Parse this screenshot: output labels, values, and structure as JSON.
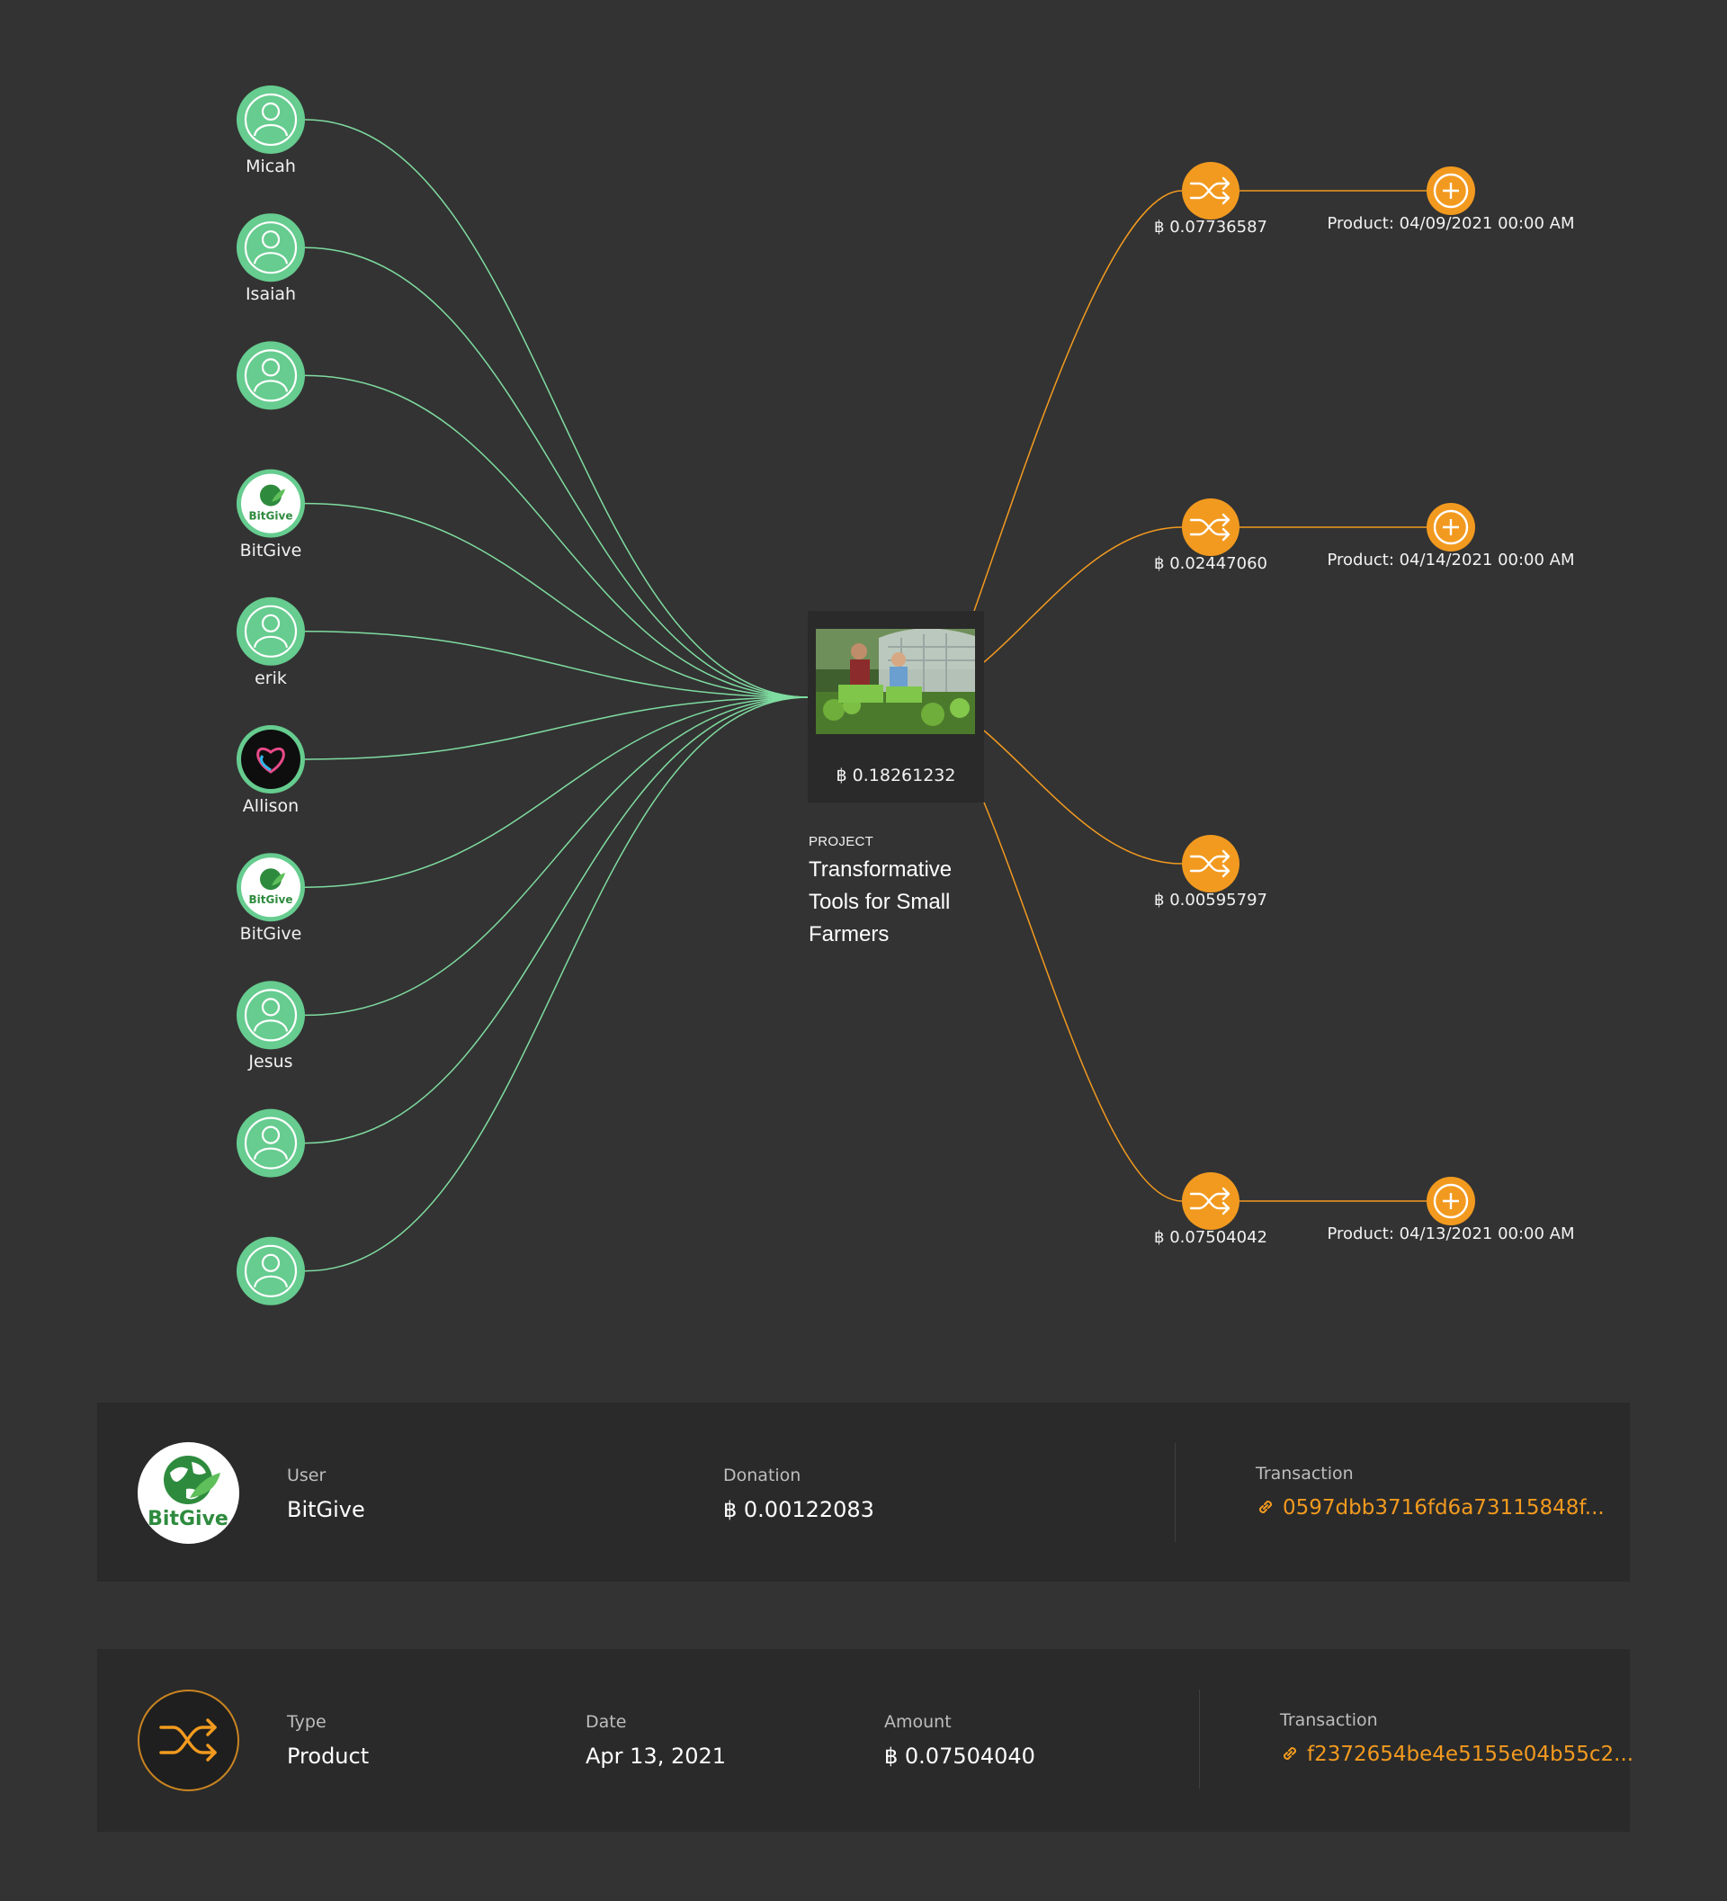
{
  "donors": [
    {
      "name": "Micah",
      "type": "user"
    },
    {
      "name": "Isaiah",
      "type": "user"
    },
    {
      "name": "",
      "type": "user"
    },
    {
      "name": "BitGive",
      "type": "bitgive",
      "logo_text": "BitGive"
    },
    {
      "name": "erik",
      "type": "user"
    },
    {
      "name": "Allison",
      "type": "heart"
    },
    {
      "name": "BitGive",
      "type": "bitgive",
      "logo_text": "BitGive"
    },
    {
      "name": "Jesus",
      "type": "user"
    },
    {
      "name": "",
      "type": "user"
    },
    {
      "name": "",
      "type": "user"
    }
  ],
  "project": {
    "amount": "฿ 0.18261232",
    "kicker": "PROJECT",
    "title": "Transformative Tools for Small Farmers"
  },
  "transactions": [
    {
      "amount": "฿ 0.07736587",
      "product": "Product: 04/09/2021 00:00 AM"
    },
    {
      "amount": "฿ 0.02447060",
      "product": "Product: 04/14/2021 00:00 AM"
    },
    {
      "amount": "฿ 0.00595797",
      "product": ""
    },
    {
      "amount": "฿ 0.07504042",
      "product": "Product: 04/13/2021 00:00 AM"
    }
  ],
  "user_panel": {
    "logo_text": "BitGive",
    "user_label": "User",
    "user_value": "BitGive",
    "donation_label": "Donation",
    "donation_value": "฿ 0.00122083",
    "transaction_label": "Transaction",
    "transaction_value": "0597dbb3716fd6a73115848f..."
  },
  "product_panel": {
    "type_label": "Type",
    "type_value": "Product",
    "date_label": "Date",
    "date_value": "Apr 13, 2021",
    "amount_label": "Amount",
    "amount_value": "฿ 0.07504040",
    "transaction_label": "Transaction",
    "transaction_value": "f2372654be4e5155e04b55c2..."
  },
  "colors": {
    "background": "#333333",
    "panel": "#2a2a2a",
    "donor_green": "#66cc8f",
    "donor_edge": "#7fdca0",
    "accent_orange": "#f29a1f",
    "bitgive_green": "#2e8b3e"
  },
  "icons": {
    "donor": "user-icon",
    "transaction": "shuffle-icon",
    "product": "plus-circle-icon",
    "link": "link-icon"
  }
}
